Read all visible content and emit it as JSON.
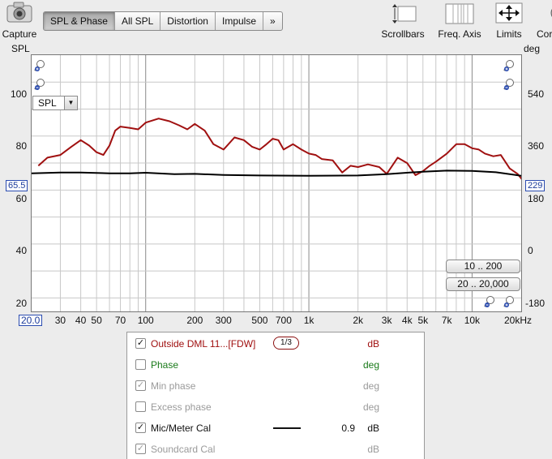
{
  "toolbar": {
    "capture_label": "Capture",
    "tabs": [
      {
        "label": "SPL & Phase",
        "active": true
      },
      {
        "label": "All SPL",
        "active": false
      },
      {
        "label": "Distortion",
        "active": false
      },
      {
        "label": "Impulse",
        "active": false
      },
      {
        "label": "»",
        "active": false
      }
    ],
    "scrollbars_label": "Scrollbars",
    "freq_axis_label": "Freq. Axis",
    "limits_label": "Limits",
    "controls_label": "Cor"
  },
  "graph": {
    "left_axis_title": "SPL",
    "right_axis_title": "deg",
    "left_ticks": [
      "100",
      "80",
      "60",
      "40",
      "20"
    ],
    "right_ticks": [
      "540",
      "360",
      "180",
      "0",
      "-180"
    ],
    "x_ticks": [
      "30",
      "40",
      "50",
      "70",
      "100",
      "200",
      "300",
      "500",
      "700",
      "1k",
      "2k",
      "3k",
      "4k",
      "5k",
      "7k",
      "10k",
      "20kHz"
    ],
    "x_start_value": "20.0",
    "cursor_left_value": "65.5",
    "cursor_right_value": "229",
    "spl_select_value": "SPL",
    "range_buttons": [
      "10 .. 200",
      "20 .. 20,000"
    ],
    "colors": {
      "spl_trace": "#a01010",
      "cal_trace": "#000000",
      "grid": "#c8c8c8",
      "cursor_box": "#2a4bb0"
    }
  },
  "legend": {
    "rows": [
      {
        "checked": true,
        "enabled": true,
        "name": "Outside DML 11...[FDW]",
        "smoothing": "1/3",
        "value": "",
        "unit": "dB",
        "color": "#a01010"
      },
      {
        "checked": false,
        "enabled": true,
        "name": "Phase",
        "value": "",
        "unit": "deg",
        "color": "#1a7a1a"
      },
      {
        "checked": true,
        "enabled": false,
        "name": "Min phase",
        "value": "",
        "unit": "deg",
        "color": "#9a9a9a"
      },
      {
        "checked": false,
        "enabled": false,
        "name": "Excess phase",
        "value": "",
        "unit": "deg",
        "color": "#9a9a9a"
      },
      {
        "checked": true,
        "enabled": true,
        "name": "Mic/Meter Cal",
        "value": "0.9",
        "unit": "dB",
        "color": "#111111"
      },
      {
        "checked": true,
        "enabled": false,
        "name": "Soundcard Cal",
        "value": "",
        "unit": "dB",
        "color": "#9a9a9a"
      }
    ]
  },
  "chart_data": {
    "type": "line",
    "xlabel": "",
    "ylabel": "SPL",
    "x_scale": "log",
    "xlim": [
      20,
      20000
    ],
    "ylim": [
      15,
      110
    ],
    "y2_label": "deg",
    "y2lim": [
      -225,
      630
    ],
    "grid": true,
    "series": [
      {
        "name": "Outside DML 11...[FDW]",
        "x": [
          22,
          25,
          30,
          35,
          40,
          45,
          50,
          55,
          60,
          65,
          70,
          80,
          90,
          100,
          120,
          140,
          160,
          180,
          200,
          230,
          260,
          300,
          350,
          400,
          450,
          500,
          550,
          600,
          650,
          700,
          800,
          900,
          1000,
          1100,
          1200,
          1400,
          1600,
          1800,
          2000,
          2300,
          2700,
          3000,
          3500,
          4000,
          4500,
          5000,
          5500,
          6000,
          7000,
          8000,
          9000,
          10000,
          11000,
          12000,
          13500,
          15000,
          17000,
          19000,
          20500
        ],
        "y": [
          69,
          72,
          73,
          76,
          78.5,
          76.5,
          74,
          73,
          76.5,
          82,
          83.5,
          83,
          82.5,
          85,
          86.5,
          85.5,
          84,
          82.5,
          84.5,
          82,
          77,
          75,
          79.5,
          78.5,
          76,
          75,
          77,
          79,
          78.5,
          75,
          77,
          75,
          73.5,
          73,
          71.5,
          71,
          66.5,
          69,
          68.5,
          69.5,
          68.5,
          66,
          72,
          70,
          65.5,
          67,
          69,
          70.5,
          73.5,
          77,
          77,
          75.5,
          75,
          73.5,
          72.5,
          73,
          68,
          66,
          63.5
        ]
      },
      {
        "name": "Mic/Meter Cal",
        "x": [
          20,
          30,
          40,
          60,
          80,
          100,
          150,
          200,
          300,
          500,
          1000,
          2000,
          3000,
          5000,
          7000,
          10000,
          14000,
          20000
        ],
        "y": [
          66.2,
          66.5,
          66.5,
          66.2,
          66.2,
          66.4,
          65.9,
          66,
          65.6,
          65.4,
          65.3,
          65.4,
          65.9,
          66.8,
          67.2,
          67.1,
          66.6,
          65.3
        ]
      }
    ]
  }
}
